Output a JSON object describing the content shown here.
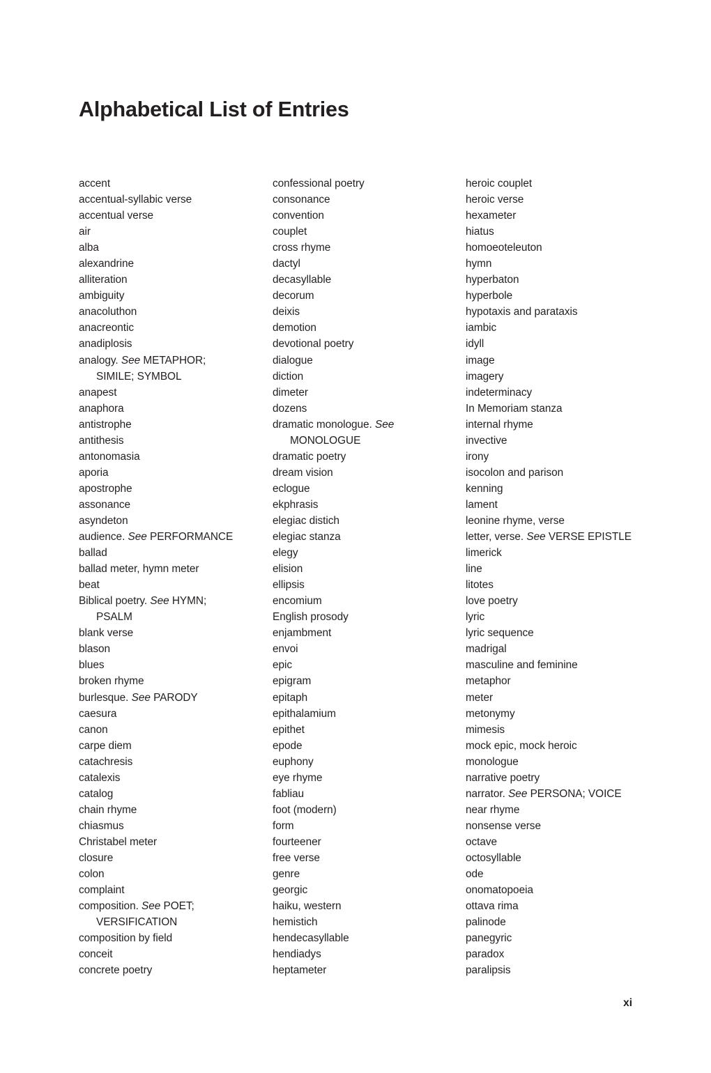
{
  "page": {
    "title": "Alphabetical List of Entries",
    "page_number": "xi",
    "text_color": "#231f20",
    "background_color": "#ffffff"
  },
  "columns": [
    {
      "name": "column-1",
      "entries": [
        {
          "text": "accent"
        },
        {
          "text": "accentual-syllabic verse"
        },
        {
          "text": "accentual verse"
        },
        {
          "text": "air"
        },
        {
          "text": "alba"
        },
        {
          "text": "alexandrine"
        },
        {
          "text": "alliteration"
        },
        {
          "text": "ambiguity"
        },
        {
          "text": "anacoluthon"
        },
        {
          "text": "anacreontic"
        },
        {
          "text": "anadiplosis"
        },
        {
          "text": "analogy. ",
          "see": "See",
          "xref": " METAPHOR;",
          "continuation": "SIMILE; SYMBOL"
        },
        {
          "text": "anapest"
        },
        {
          "text": "anaphora"
        },
        {
          "text": "antistrophe"
        },
        {
          "text": "antithesis"
        },
        {
          "text": "antonomasia"
        },
        {
          "text": "aporia"
        },
        {
          "text": "apostrophe"
        },
        {
          "text": "assonance"
        },
        {
          "text": "asyndeton"
        },
        {
          "text": "audience. ",
          "see": "See",
          "xref": " PERFORMANCE"
        },
        {
          "text": "ballad"
        },
        {
          "text": "ballad meter, hymn meter"
        },
        {
          "text": "beat"
        },
        {
          "text": "Biblical poetry. ",
          "see": "See",
          "xref": " HYMN;",
          "continuation": "PSALM"
        },
        {
          "text": "blank verse"
        },
        {
          "text": "blason"
        },
        {
          "text": "blues"
        },
        {
          "text": "broken rhyme"
        },
        {
          "text": "burlesque. ",
          "see": "See",
          "xref": " PARODY"
        },
        {
          "text": "caesura"
        },
        {
          "text": "canon"
        },
        {
          "text": "carpe diem"
        },
        {
          "text": "catachresis"
        },
        {
          "text": "catalexis"
        },
        {
          "text": "catalog"
        },
        {
          "text": "chain rhyme"
        },
        {
          "text": "chiasmus"
        },
        {
          "text": "Christabel meter"
        },
        {
          "text": "closure"
        },
        {
          "text": "colon"
        },
        {
          "text": "complaint"
        },
        {
          "text": "composition. ",
          "see": "See",
          "xref": " POET;",
          "continuation": "VERSIFICATION"
        },
        {
          "text": "composition by field"
        },
        {
          "text": "conceit"
        },
        {
          "text": "concrete poetry"
        }
      ]
    },
    {
      "name": "column-2",
      "entries": [
        {
          "text": "confessional poetry"
        },
        {
          "text": "consonance"
        },
        {
          "text": "convention"
        },
        {
          "text": "couplet"
        },
        {
          "text": "cross rhyme"
        },
        {
          "text": "dactyl"
        },
        {
          "text": "decasyllable"
        },
        {
          "text": "decorum"
        },
        {
          "text": "deixis"
        },
        {
          "text": "demotion"
        },
        {
          "text": "devotional poetry"
        },
        {
          "text": "dialogue"
        },
        {
          "text": "diction"
        },
        {
          "text": "dimeter"
        },
        {
          "text": "dozens"
        },
        {
          "text": "dramatic monologue. ",
          "see": "See",
          "xref": "",
          "continuation": "MONOLOGUE"
        },
        {
          "text": "dramatic poetry"
        },
        {
          "text": "dream vision"
        },
        {
          "text": "eclogue"
        },
        {
          "text": "ekphrasis"
        },
        {
          "text": "elegiac distich"
        },
        {
          "text": "elegiac stanza"
        },
        {
          "text": "elegy"
        },
        {
          "text": "elision"
        },
        {
          "text": "ellipsis"
        },
        {
          "text": "encomium"
        },
        {
          "text": "English prosody"
        },
        {
          "text": "enjambment"
        },
        {
          "text": "envoi"
        },
        {
          "text": "epic"
        },
        {
          "text": "epigram"
        },
        {
          "text": "epitaph"
        },
        {
          "text": "epithalamium"
        },
        {
          "text": "epithet"
        },
        {
          "text": "epode"
        },
        {
          "text": "euphony"
        },
        {
          "text": "eye rhyme"
        },
        {
          "text": "fabliau"
        },
        {
          "text": "foot (modern)"
        },
        {
          "text": "form"
        },
        {
          "text": "fourteener"
        },
        {
          "text": "free verse"
        },
        {
          "text": "genre"
        },
        {
          "text": "georgic"
        },
        {
          "text": "haiku, western"
        },
        {
          "text": "hemistich"
        },
        {
          "text": "hendecasyllable"
        },
        {
          "text": "hendiadys"
        },
        {
          "text": "heptameter"
        }
      ]
    },
    {
      "name": "column-3",
      "entries": [
        {
          "text": "heroic couplet"
        },
        {
          "text": "heroic verse"
        },
        {
          "text": "hexameter"
        },
        {
          "text": "hiatus"
        },
        {
          "text": "homoeoteleuton"
        },
        {
          "text": "hymn"
        },
        {
          "text": "hyperbaton"
        },
        {
          "text": "hyperbole"
        },
        {
          "text": "hypotaxis and parataxis"
        },
        {
          "text": "iambic"
        },
        {
          "text": "idyll"
        },
        {
          "text": "image"
        },
        {
          "text": "imagery"
        },
        {
          "text": "indeterminacy"
        },
        {
          "text": "In Memoriam stanza"
        },
        {
          "text": "internal rhyme"
        },
        {
          "text": "invective"
        },
        {
          "text": "irony"
        },
        {
          "text": "isocolon and parison"
        },
        {
          "text": "kenning"
        },
        {
          "text": "lament"
        },
        {
          "text": "leonine rhyme, verse"
        },
        {
          "text": "letter, verse. ",
          "see": "See",
          "xref": " VERSE EPISTLE"
        },
        {
          "text": "limerick"
        },
        {
          "text": "line"
        },
        {
          "text": "litotes"
        },
        {
          "text": "love poetry"
        },
        {
          "text": "lyric"
        },
        {
          "text": "lyric sequence"
        },
        {
          "text": "madrigal"
        },
        {
          "text": "masculine and feminine"
        },
        {
          "text": "metaphor"
        },
        {
          "text": "meter"
        },
        {
          "text": "metonymy"
        },
        {
          "text": "mimesis"
        },
        {
          "text": "mock epic, mock heroic"
        },
        {
          "text": "monologue"
        },
        {
          "text": "narrative poetry"
        },
        {
          "text": "narrator. ",
          "see": "See",
          "xref": " PERSONA; VOICE"
        },
        {
          "text": "near rhyme"
        },
        {
          "text": "nonsense verse"
        },
        {
          "text": "octave"
        },
        {
          "text": "octosyllable"
        },
        {
          "text": "ode"
        },
        {
          "text": "onomatopoeia"
        },
        {
          "text": "ottava rima"
        },
        {
          "text": "palinode"
        },
        {
          "text": "panegyric"
        },
        {
          "text": "paradox"
        },
        {
          "text": "paralipsis"
        }
      ]
    }
  ]
}
